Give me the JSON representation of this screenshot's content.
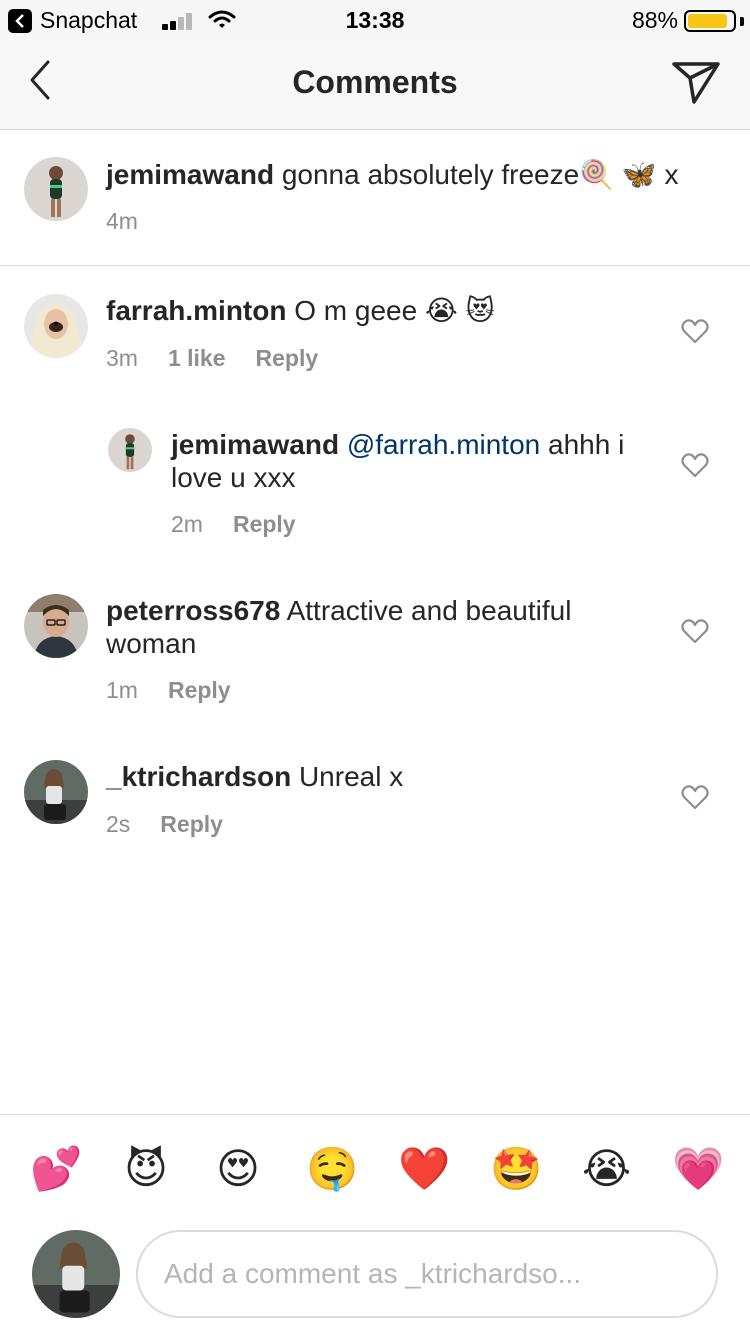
{
  "status_bar": {
    "app": "Snapchat",
    "time": "13:38",
    "battery": "88%",
    "battery_level": 0.88
  },
  "header": {
    "title": "Comments",
    "back_icon": "chevron-left-icon",
    "send_icon": "paper-plane-icon"
  },
  "caption": {
    "username": "jemimawand",
    "text": " gonna absolutely freeze🍭 🦋 x",
    "time": "4m"
  },
  "comments": [
    {
      "username": "farrah.minton",
      "text": " O m geee 😭 😻",
      "time": "3m",
      "likes": "1 like",
      "reply": "Reply"
    },
    {
      "username": "jemimawand",
      "mention": "@farrah.minton",
      "text": " ahhh i love u xxx",
      "time": "2m",
      "reply": "Reply"
    },
    {
      "username": "peterross678",
      "text": " Attractive and beautiful woman",
      "time": "1m",
      "reply": "Reply"
    },
    {
      "username": "_ktrichardson",
      "text": " Unreal x",
      "time": "2s",
      "reply": "Reply"
    }
  ],
  "emoji_bar": [
    "💕",
    "😈",
    "😍",
    "🤤",
    "❤️",
    "🤩",
    "😭",
    "💗"
  ],
  "composer": {
    "placeholder": "Add a comment as _ktrichardso..."
  },
  "colors": {
    "text": "#262626",
    "secondary": "#8e8e8e",
    "mention": "#003569",
    "battery": "#f6c515"
  }
}
